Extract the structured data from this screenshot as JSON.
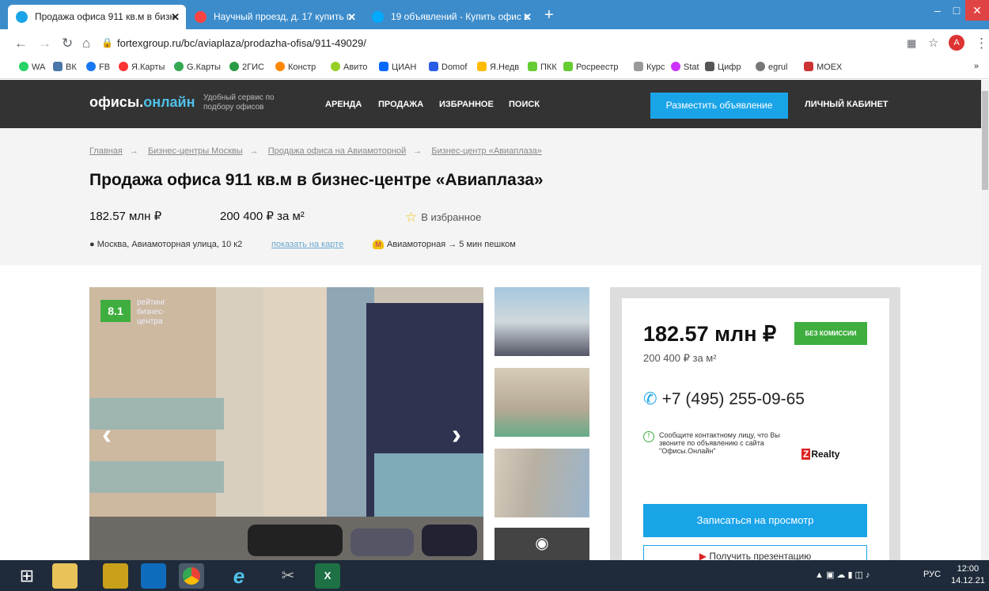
{
  "browser": {
    "tabs": [
      {
        "label": "Продажа офиса 911 кв.м в бизн",
        "active": true
      },
      {
        "label": "Научный проезд, д. 17 купить п",
        "active": false
      },
      {
        "label": "19 объявлений - Купить офис в",
        "active": false
      }
    ],
    "new_tab": "+",
    "url": "fortexgroup.ru/bc/aviaplaza/prodazha-ofisa/911-49029/",
    "profile_initial": "A",
    "bookmarks": [
      "WA",
      "ВК",
      "FB",
      "Я.Карты",
      "G.Карты",
      "2ГИС",
      "Констр",
      "Авито",
      "ЦИАН",
      "Domof",
      "Я.Недв",
      "ПКК",
      "Росреестр",
      "Курс",
      "Stat",
      "Цифр",
      "egrul",
      "MOEX"
    ],
    "more_bookmarks": "»"
  },
  "site": {
    "logo_main": "офисы.",
    "logo_accent": "онлайн",
    "tagline": "Удобный сервис по подбору офисов",
    "nav": [
      "АРЕНДА",
      "ПРОДАЖА",
      "ИЗБРАННОЕ",
      "ПОИСК"
    ],
    "post_button": "Разместить объявление",
    "cabinet": "ЛИЧНЫЙ КАБИНЕТ"
  },
  "breadcrumbs": [
    "Главная",
    "Бизнес-центры Москвы",
    "Продажа офиса на Авиамоторной",
    "Бизнес-центр «Авиаплаза»"
  ],
  "breadcrumb_sep": "→",
  "listing": {
    "title": "Продажа офиса 911 кв.м в бизнес-центре «Авиаплаза»",
    "price": "182.57 млн ₽",
    "price_per_m2": "200 400 ₽ за м²",
    "favorite": "В избранное",
    "address": "Москва, Авиамоторная улица, 10 к2",
    "map_link": "показать на карте",
    "metro": "Авиамоторная → 5 мин пешком",
    "metro_letter": "М"
  },
  "gallery": {
    "rating": "8.1",
    "rating_label": "рейтинг бизнес-центра"
  },
  "card": {
    "price": "182.57 млн ₽",
    "no_commission": "БЕЗ КОМИССИИ",
    "price_per_m2": "200 400 ₽ за м²",
    "phone": "+7 (495) 255-09-65",
    "note": "Сообщите контактному лицу, что Вы звоните по объявлению с сайта \"Офисы.Онлайн\"",
    "agency": "Realty",
    "agency_letter": "Z",
    "book_button": "Записаться на просмотр",
    "second_button": "Получить презентацию"
  },
  "taskbar": {
    "lang": "РУС",
    "time": "12:00",
    "date": "14.12.21"
  }
}
